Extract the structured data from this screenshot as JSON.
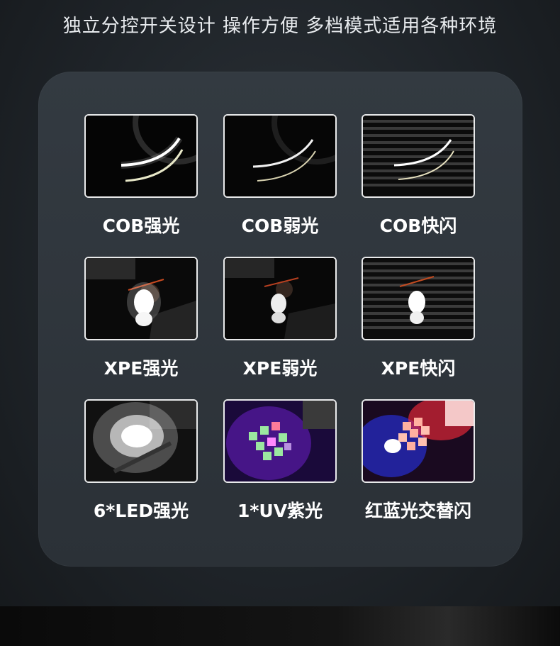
{
  "headline": "独立分控开关设计 操作方便 多档模式适用各种环境",
  "modes": [
    {
      "label": "COB强光",
      "icon": "cob-strong-light-icon"
    },
    {
      "label": "COB弱光",
      "icon": "cob-weak-light-icon"
    },
    {
      "label": "COB快闪",
      "icon": "cob-fast-flash-icon"
    },
    {
      "label": "XPE强光",
      "icon": "xpe-strong-light-icon"
    },
    {
      "label": "XPE弱光",
      "icon": "xpe-weak-light-icon"
    },
    {
      "label": "XPE快闪",
      "icon": "xpe-fast-flash-icon"
    },
    {
      "label": "6*LED强光",
      "icon": "six-led-strong-light-icon"
    },
    {
      "label": "1*UV紫光",
      "icon": "uv-purple-light-icon"
    },
    {
      "label": "红蓝光交替闪",
      "icon": "red-blue-alternating-flash-icon"
    }
  ],
  "colors": {
    "panel": "#2f363c",
    "background": "#1f2429",
    "text": "#ffffff",
    "uv": "#5a1aa8",
    "red": "#ff2a3a",
    "blue": "#2a36ff"
  }
}
